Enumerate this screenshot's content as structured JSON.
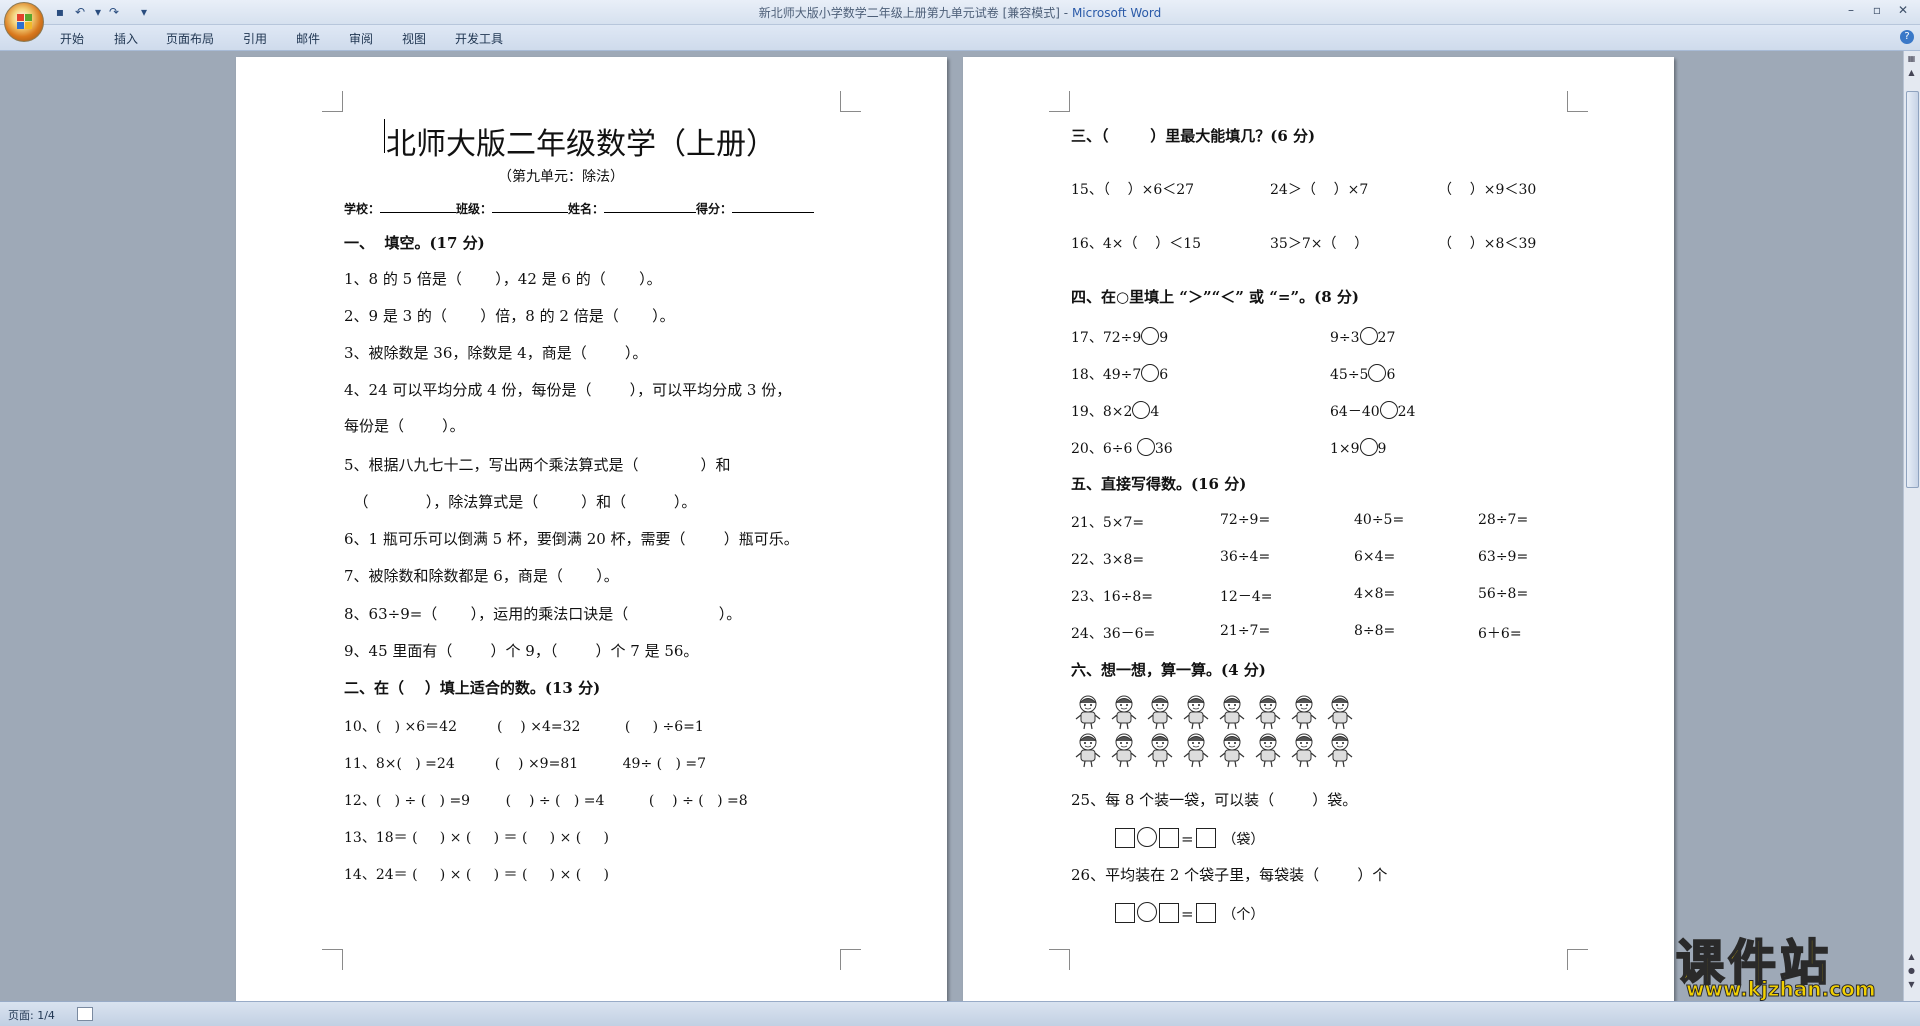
{
  "window": {
    "title": "新北师大版小学数学二年级上册第九单元试卷 [兼容模式]",
    "title_sep": " - ",
    "app_name": "Microsoft Word"
  },
  "ribbon": {
    "tabs": [
      "开始",
      "插入",
      "页面布局",
      "引用",
      "邮件",
      "审阅",
      "视图",
      "开发工具"
    ]
  },
  "left_page": {
    "title": "北师大版二年级数学（上册）",
    "subtitle": "（第九单元：除法）",
    "info": {
      "school": "学校：",
      "class": "班级：",
      "name": "姓名：",
      "score": "得分："
    },
    "lines": [
      "一、  填空。(17 分)",
      "1、8 的 5 倍是（       ），42 是 6 的（       ）。",
      "2、9 是 3 的（       ）倍，8 的 2 倍是（       ）。",
      "3、被除数是 36，除数是 4，商是（        ）。",
      "4、24 可以平均分成 4 份，每份是（        ），可以平均分成 3 份，",
      "每份是（        ）。",
      "5、根据八九七十二，写出两个乘法算式是（             ）和",
      "  （            ），除法算式是（         ）和（          ）。",
      "6、1 瓶可乐可以倒满 5 杯，要倒满 20 杯，需要（        ）瓶可乐。",
      "7、被除数和除数都是 6，商是（       ）。",
      "8、63÷9=（       ），运用的乘法口诀是（                   ）。",
      "9、45 里面有（        ）个 9，（        ）个 7 是 56。",
      "二、在（    ）填上适合的数。(13 分)",
      "10、(   ) ×6＝42         (    ) ×4=32          (     ) ÷6=1",
      "11、8×(   ) =24         (    ) ×9=81          49÷ (   ) =7",
      "12、(   ) ÷ (   ) =9        (    ) ÷ (   ) =4          (    ) ÷ (   ) =8",
      "13、18＝ (     ) × (     ) ＝ (     ) × (     )",
      "14、24＝ (     ) × (     ) ＝ (     ) × (     )"
    ]
  },
  "right_page": {
    "sec3": "三、（        ）里最大能填几？(6 分)",
    "q15": [
      "15、（    ）×6＜27",
      "24＞（    ）×7",
      "（    ）×9＜30"
    ],
    "q16": [
      "16、4×（    ）＜15",
      "35＞7×（    ）",
      "（    ）×8＜39"
    ],
    "sec4": "四、在○里填上 “＞”“＜” 或 “=”。(8 分)",
    "q4": [
      [
        "17、72÷9",
        "9",
        "9÷3",
        "27"
      ],
      [
        "18、49÷7",
        "6",
        "45÷5",
        "6"
      ],
      [
        "19、8×2",
        "4",
        "64－40",
        "24"
      ],
      [
        "20、6÷6 ",
        "36",
        "1×9",
        "9"
      ]
    ],
    "sec5": "五、直接写得数。(16 分)",
    "q5": [
      [
        "21、5×7=",
        "72÷9=",
        "40÷5=",
        "28÷7="
      ],
      [
        "22、3×8=",
        "36÷4=",
        "6×4=",
        "63÷9="
      ],
      [
        "23、16÷8=",
        "12－4=",
        "4×8=",
        "56÷8="
      ],
      [
        "24、36－6=",
        "21÷7=",
        "8÷8=",
        "6＋6="
      ]
    ],
    "sec6": "六、想一想，算一算。(4 分)",
    "q25": "25、每 8 个装一袋，可以装（        ）袋。",
    "unit25": "（袋）",
    "q26": "26、平均装在 2 个袋子里，每袋装（        ）个",
    "unit26": "（个）",
    "equals": "="
  },
  "status": {
    "page": "页面: 1/4"
  },
  "watermark": {
    "cn": "课件站",
    "url": "www.kjzhan.com"
  }
}
